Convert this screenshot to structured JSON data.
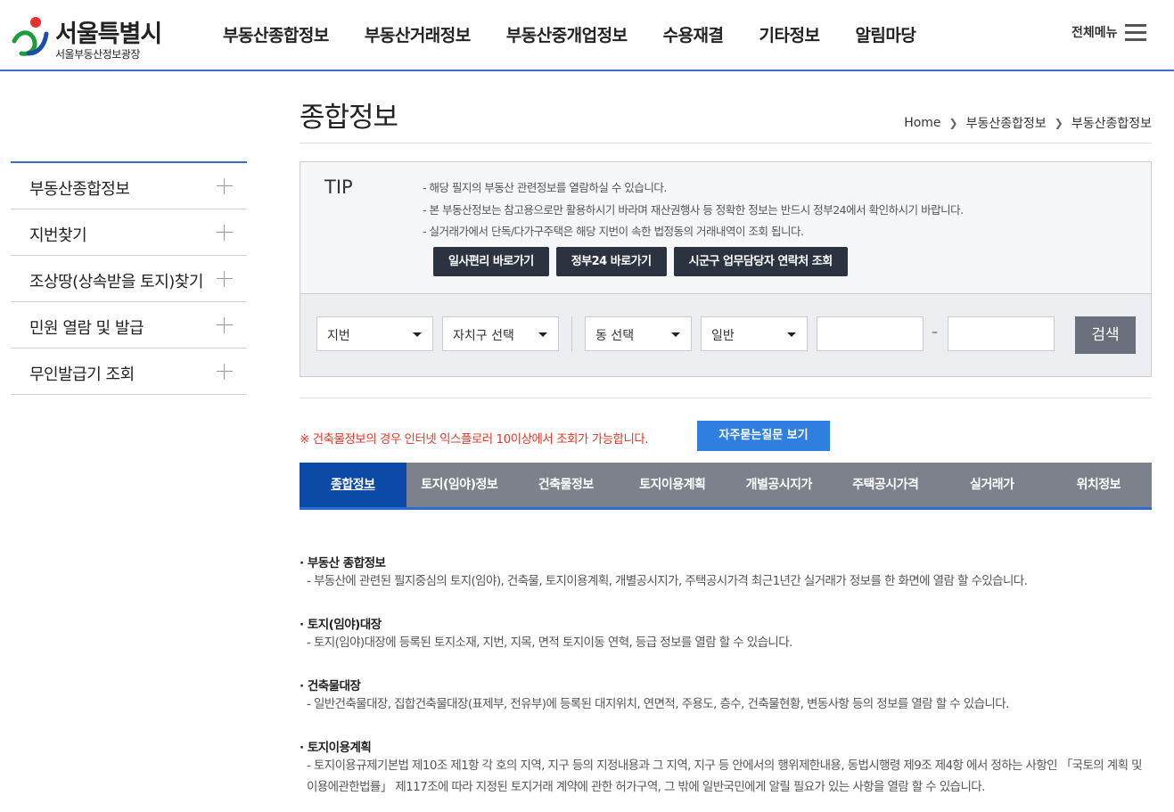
{
  "header": {
    "logo_title": "서울특별시",
    "logo_sub": "서울부동산정보광장",
    "gnb": [
      "부동산종합정보",
      "부동산거래정보",
      "부동산중개업정보",
      "수용재결",
      "기타정보",
      "알림마당"
    ],
    "allmenu_label": "전체메뉴"
  },
  "sidebar": {
    "items": [
      {
        "label": "부동산종합정보"
      },
      {
        "label": "지번찾기"
      },
      {
        "label": "조상땅(상속받을 토지)찾기"
      },
      {
        "label": "민원 열람 및 발급"
      },
      {
        "label": "무인발급기 조회"
      }
    ]
  },
  "page": {
    "title": "종합정보",
    "breadcrumb": [
      "Home",
      "부동산종합정보",
      "부동산종합정보"
    ]
  },
  "tip": {
    "title": "TIP",
    "lines": [
      "-  해당 필지의 부동산 관련정보를 열람하실 수 있습니다.",
      "-  본 부동산정보는 참고용으로만 활용하시기 바라며 재산권행사 등 정확한 정보는 반드시 정부24에서 확인하시기 바랍니다.",
      "-  실거래가에서 단독/다가구주택은 해당 지번이 속한 법정동의 거래내역이 조회 됩니다."
    ],
    "buttons": [
      "일사편리 바로가기",
      "정부24 바로가기",
      "시군구 업무담당자 연락처 조회"
    ]
  },
  "search": {
    "type_select": "지번",
    "gu_select": "자치구 선택",
    "dong_select": "동 선택",
    "kind_select": "일반",
    "main_number": "",
    "sub_number": "",
    "dash": "–",
    "button": "검색"
  },
  "notice": {
    "text": "※ 건축물정보의 경우 인터넷 익스플로러 10이상에서 조회가 가능합니다.",
    "faq_button": "자주묻는질문 보기"
  },
  "tabs": [
    {
      "label": "종합정보",
      "active": true
    },
    {
      "label": "토지(임야)정보"
    },
    {
      "label": "건축물정보"
    },
    {
      "label": "토지이용계획"
    },
    {
      "label": "개별공시지가"
    },
    {
      "label": "주택공시가격"
    },
    {
      "label": "실거래가"
    },
    {
      "label": "위치정보"
    }
  ],
  "content": {
    "sections": [
      {
        "title": "· 부동산 종합정보",
        "desc": "- 부동산에 관련된 필지중심의 토지(임야), 건축물, 토지이용계획, 개별공시지가, 주택공시가격 최근1년간 실거래가 정보를 한 화면에 열람 할 수있습니다."
      },
      {
        "title": "· 토지(임야)대장",
        "desc": "- 토지(임야)대장에 등록된 토지소재, 지번, 지목, 면적 토지이동 연혁, 등급 정보를 열람 할 수 있습니다."
      },
      {
        "title": "· 건축물대장",
        "desc": "- 일반건축물대장, 집합건축물대장(표제부, 전유부)에 등록된 대지위치, 연면적, 주용도, 층수, 건축물현황, 변동사항 등의 정보를 열람 할 수 있습니다."
      },
      {
        "title": "· 토지이용계획",
        "desc": "- 토지이용규제기본법 제10조 제1항 각 호의 지역, 지구 등의 지정내용과 그 지역, 지구 등 안에서의 행위제한내용, 동법시행령 제9조 제4항 에서 정하는 사항인 「국토의 계획 및 이용에관한법률」 제117조에 따라 지정된 토지거래 계약에 관한 허가구역, 그 밖에 일반국민에게 알릴 필요가 있는 사항을 열람 할 수 있습니다."
      }
    ]
  },
  "colors": {
    "brand_blue": "#3a6fc4",
    "tab_active": "#0b4aa6",
    "tab_bg": "#7d818b",
    "faq_button": "#2f7fe0",
    "notice_red": "#e03a2a",
    "tip_button": "#2b3340"
  }
}
